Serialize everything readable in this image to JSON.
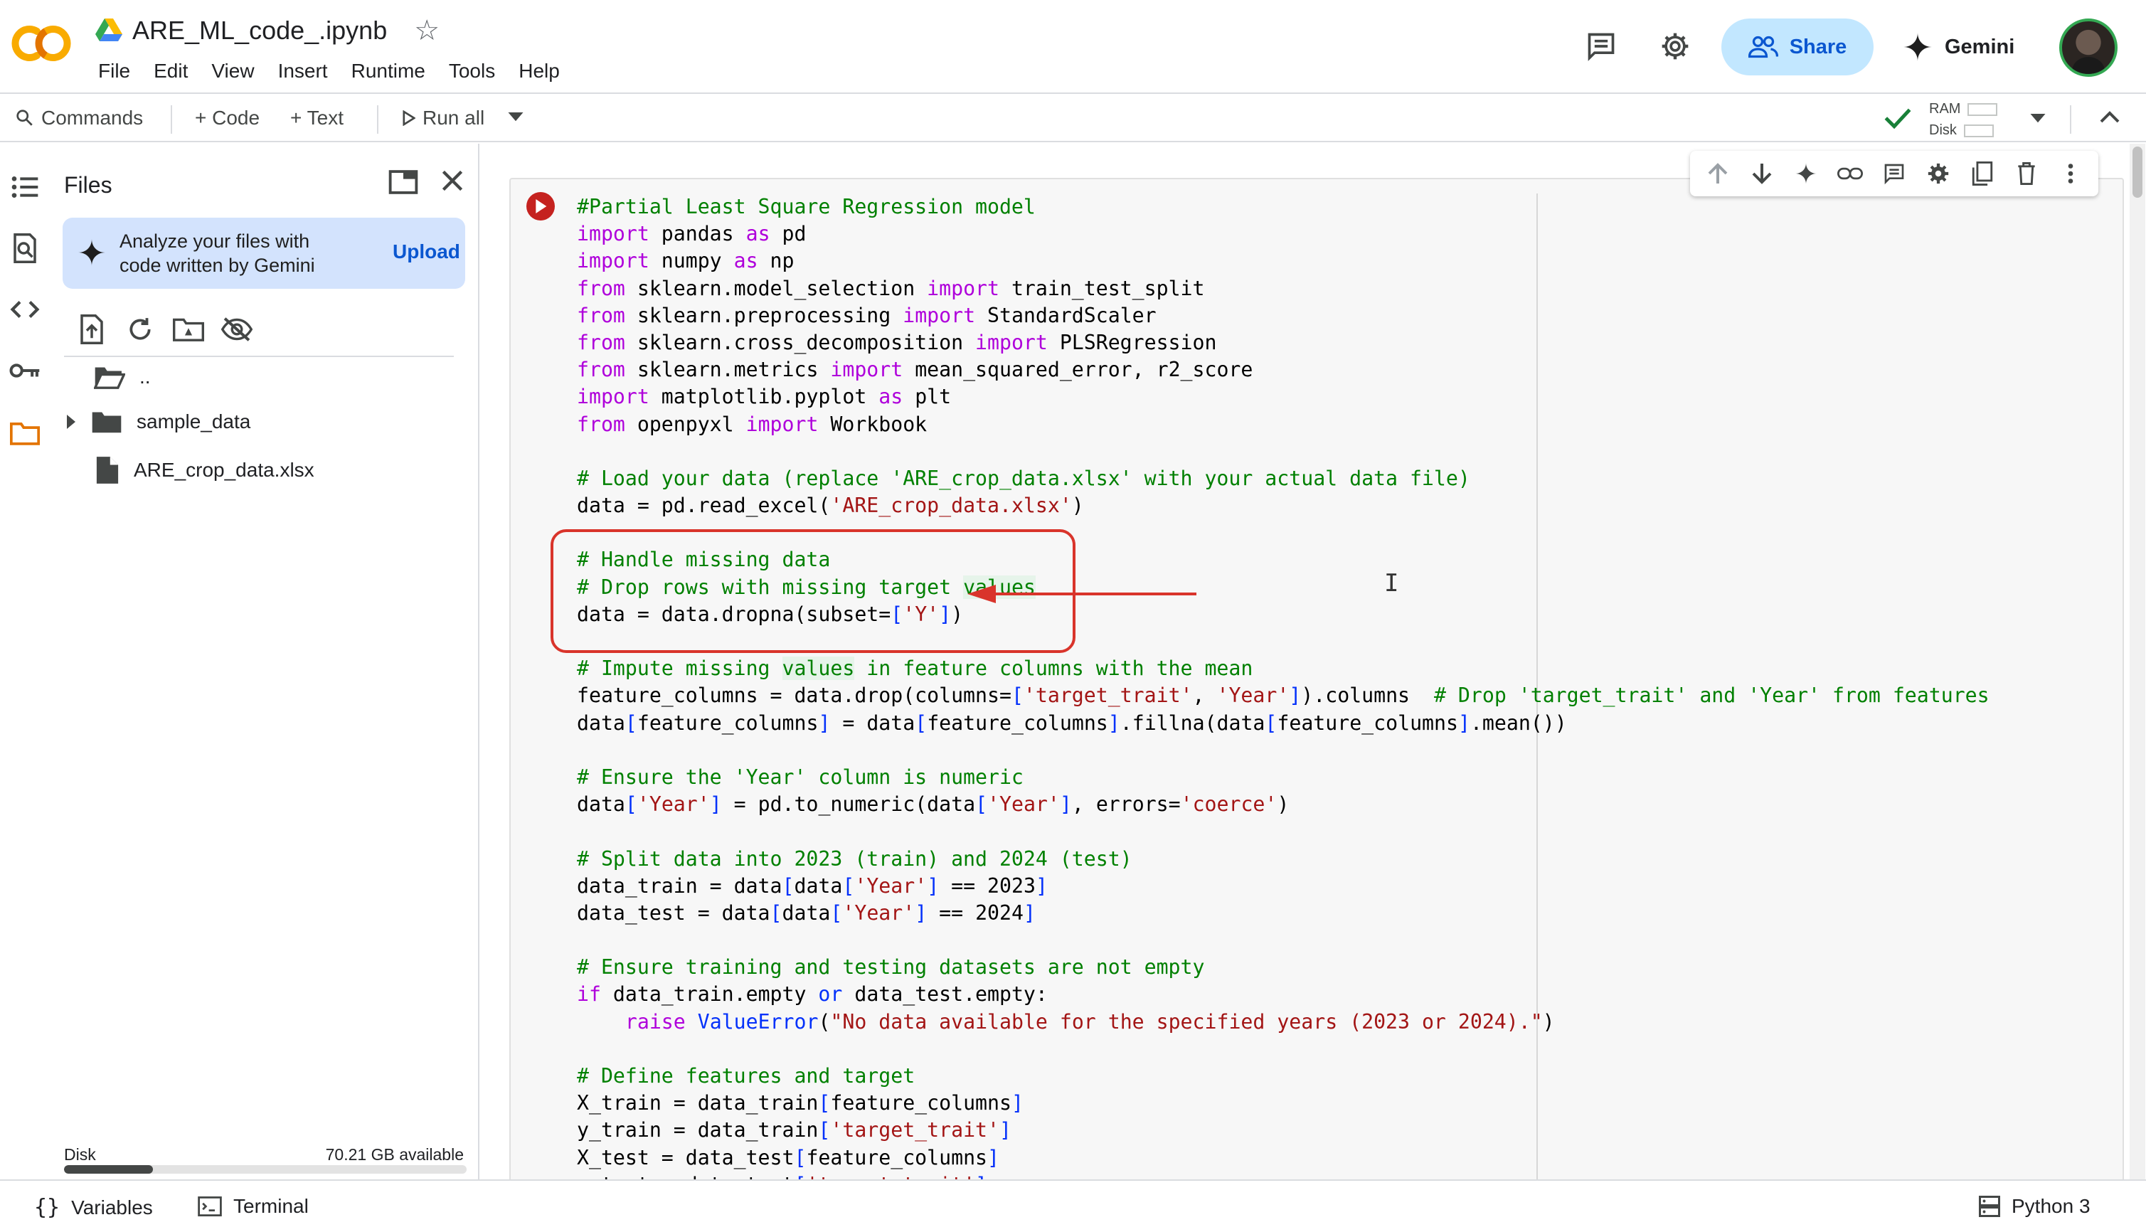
{
  "notebook": {
    "title": "ARE_ML_code_.ipynb"
  },
  "menu": [
    "File",
    "Edit",
    "View",
    "Insert",
    "Runtime",
    "Tools",
    "Help"
  ],
  "header": {
    "share_label": "Share",
    "gemini_label": "Gemini"
  },
  "toolbar": {
    "commands_label": "Commands",
    "code_label": "+ Code",
    "text_label": "+ Text",
    "run_all_label": "Run all",
    "ram_label": "RAM",
    "disk_label": "Disk"
  },
  "files_panel": {
    "title": "Files",
    "gemini_card_text": "Analyze your files with code written by Gemini",
    "upload_label": "Upload",
    "tree": [
      {
        "name": "..",
        "type": "parent"
      },
      {
        "name": "sample_data",
        "type": "folder"
      },
      {
        "name": "ARE_crop_data.xlsx",
        "type": "file"
      }
    ],
    "disk_label": "Disk",
    "disk_available": "70.21 GB available",
    "disk_used_fraction": 0.22
  },
  "code_cell": {
    "lines": [
      [
        [
          "cm",
          "#Partial Least Square Regression model"
        ]
      ],
      [
        [
          "kw",
          "import"
        ],
        [
          "",
          " pandas "
        ],
        [
          "kw",
          "as"
        ],
        [
          "",
          " pd"
        ]
      ],
      [
        [
          "kw",
          "import"
        ],
        [
          "",
          " numpy "
        ],
        [
          "kw",
          "as"
        ],
        [
          "",
          " np"
        ]
      ],
      [
        [
          "kw",
          "from"
        ],
        [
          "",
          " sklearn.model_selection "
        ],
        [
          "kw",
          "import"
        ],
        [
          "",
          " train_test_split"
        ]
      ],
      [
        [
          "kw",
          "from"
        ],
        [
          "",
          " sklearn.preprocessing "
        ],
        [
          "kw",
          "import"
        ],
        [
          "",
          " StandardScaler"
        ]
      ],
      [
        [
          "kw",
          "from"
        ],
        [
          "",
          " sklearn.cross_decomposition "
        ],
        [
          "kw",
          "import"
        ],
        [
          "",
          " PLSRegression"
        ]
      ],
      [
        [
          "kw",
          "from"
        ],
        [
          "",
          " sklearn.metrics "
        ],
        [
          "kw",
          "import"
        ],
        [
          "",
          " mean_squared_error, r2_score"
        ]
      ],
      [
        [
          "kw",
          "import"
        ],
        [
          "",
          " matplotlib.pyplot "
        ],
        [
          "kw",
          "as"
        ],
        [
          "",
          " plt"
        ]
      ],
      [
        [
          "kw",
          "from"
        ],
        [
          "",
          " openpyxl "
        ],
        [
          "kw",
          "import"
        ],
        [
          "",
          " Workbook"
        ]
      ],
      [],
      [
        [
          "cm",
          "# Load your data (replace 'ARE_crop_data.xlsx' with your actual data file)"
        ]
      ],
      [
        [
          "",
          "data = pd.read_excel("
        ],
        [
          "st",
          "'ARE_crop_data.xlsx'"
        ],
        [
          "",
          ")"
        ]
      ],
      [],
      [
        [
          "cm",
          "# Handle missing data"
        ]
      ],
      [
        [
          "cm",
          "# Drop rows with missing target "
        ],
        [
          "cmhl",
          "values"
        ]
      ],
      [
        [
          "",
          "data = data.dropna(subset="
        ],
        [
          "bl",
          "["
        ],
        [
          "st",
          "'Y'"
        ],
        [
          "bl",
          "]"
        ],
        [
          "",
          ")"
        ]
      ],
      [],
      [
        [
          "cm",
          "# Impute missing "
        ],
        [
          "cmhl",
          "values"
        ],
        [
          "cm",
          " in feature columns with the mean"
        ]
      ],
      [
        [
          "",
          "feature_columns = data.drop(columns="
        ],
        [
          "bl",
          "["
        ],
        [
          "st",
          "'target_trait'"
        ],
        [
          "",
          ", "
        ],
        [
          "st",
          "'Year'"
        ],
        [
          "bl",
          "]"
        ],
        [
          "",
          ").columns  "
        ],
        [
          "cm",
          "# Drop 'target_trait' and 'Year' from features"
        ]
      ],
      [
        [
          "",
          "data"
        ],
        [
          "bl",
          "["
        ],
        [
          "",
          "feature_columns"
        ],
        [
          "bl",
          "]"
        ],
        [
          "",
          " = data"
        ],
        [
          "bl",
          "["
        ],
        [
          "",
          "feature_columns"
        ],
        [
          "bl",
          "]"
        ],
        [
          "",
          ".fillna(data"
        ],
        [
          "bl",
          "["
        ],
        [
          "",
          "feature_columns"
        ],
        [
          "bl",
          "]"
        ],
        [
          "",
          ".mean())"
        ]
      ],
      [],
      [
        [
          "cm",
          "# Ensure the 'Year' column is numeric"
        ]
      ],
      [
        [
          "",
          "data"
        ],
        [
          "bl",
          "["
        ],
        [
          "st",
          "'Year'"
        ],
        [
          "bl",
          "]"
        ],
        [
          "",
          " = pd.to_numeric(data"
        ],
        [
          "bl",
          "["
        ],
        [
          "st",
          "'Year'"
        ],
        [
          "bl",
          "]"
        ],
        [
          "",
          ", errors="
        ],
        [
          "st",
          "'coerce'"
        ],
        [
          "",
          ")"
        ]
      ],
      [],
      [
        [
          "cm",
          "# Split data into 2023 (train) and 2024 (test)"
        ]
      ],
      [
        [
          "",
          "data_train = data"
        ],
        [
          "bl",
          "["
        ],
        [
          "",
          "data"
        ],
        [
          "bl",
          "["
        ],
        [
          "st",
          "'Year'"
        ],
        [
          "bl",
          "]"
        ],
        [
          "",
          " == 2023"
        ],
        [
          "bl",
          "]"
        ]
      ],
      [
        [
          "",
          "data_test = data"
        ],
        [
          "bl",
          "["
        ],
        [
          "",
          "data"
        ],
        [
          "bl",
          "["
        ],
        [
          "st",
          "'Year'"
        ],
        [
          "bl",
          "]"
        ],
        [
          "",
          " == 2024"
        ],
        [
          "bl",
          "]"
        ]
      ],
      [],
      [
        [
          "cm",
          "# Ensure training and testing datasets are not empty"
        ]
      ],
      [
        [
          "kw",
          "if"
        ],
        [
          "",
          " data_train.empty "
        ],
        [
          "bl",
          "or"
        ],
        [
          "",
          " data_test.empty:"
        ]
      ],
      [
        [
          "",
          "    "
        ],
        [
          "kw",
          "raise"
        ],
        [
          "",
          " "
        ],
        [
          "bl",
          "ValueError"
        ],
        [
          "",
          "("
        ],
        [
          "st",
          "\"No data available for the specified years (2023 or 2024).\""
        ],
        [
          "",
          ")"
        ]
      ],
      [],
      [
        [
          "cm",
          "# Define features and target"
        ]
      ],
      [
        [
          "",
          "X_train = data_train"
        ],
        [
          "bl",
          "["
        ],
        [
          "",
          "feature_columns"
        ],
        [
          "bl",
          "]"
        ]
      ],
      [
        [
          "",
          "y_train = data_train"
        ],
        [
          "bl",
          "["
        ],
        [
          "st",
          "'target_trait'"
        ],
        [
          "bl",
          "]"
        ]
      ],
      [
        [
          "",
          "X_test = data_test"
        ],
        [
          "bl",
          "["
        ],
        [
          "",
          "feature_columns"
        ],
        [
          "bl",
          "]"
        ]
      ],
      [
        [
          "",
          "y_test = data_test"
        ],
        [
          "bl",
          "["
        ],
        [
          "st",
          "'target_trait'"
        ],
        [
          "bl",
          "]"
        ]
      ]
    ]
  },
  "statusbar": {
    "variables_label": "Variables",
    "terminal_label": "Terminal",
    "runtime_label": "Python 3"
  },
  "colors": {
    "accent": "#0b57d0",
    "share_bg": "#c2e7ff",
    "annotation": "#d9342b",
    "run_button": "#c5221f"
  }
}
